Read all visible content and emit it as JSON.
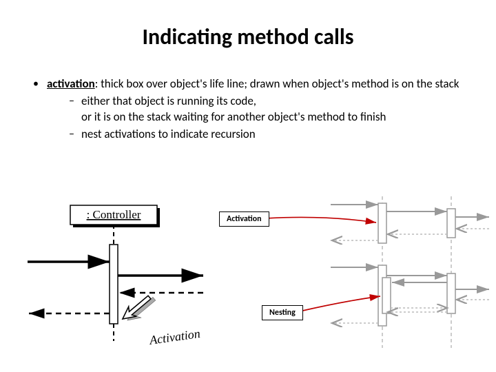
{
  "title": "Indicating method calls",
  "bullet": {
    "term": "activation",
    "def": ": thick box over object's life line; drawn when object's method is on the stack",
    "sub1_line1": "either that object is running its code,",
    "sub1_line2": "or it is on the stack waiting for another object's method to finish",
    "sub2": "nest activations to indicate recursion"
  },
  "labels": {
    "controller": ": Controller",
    "activation": "Activation",
    "nesting": "Nesting",
    "activation_handwritten": "Activation"
  }
}
